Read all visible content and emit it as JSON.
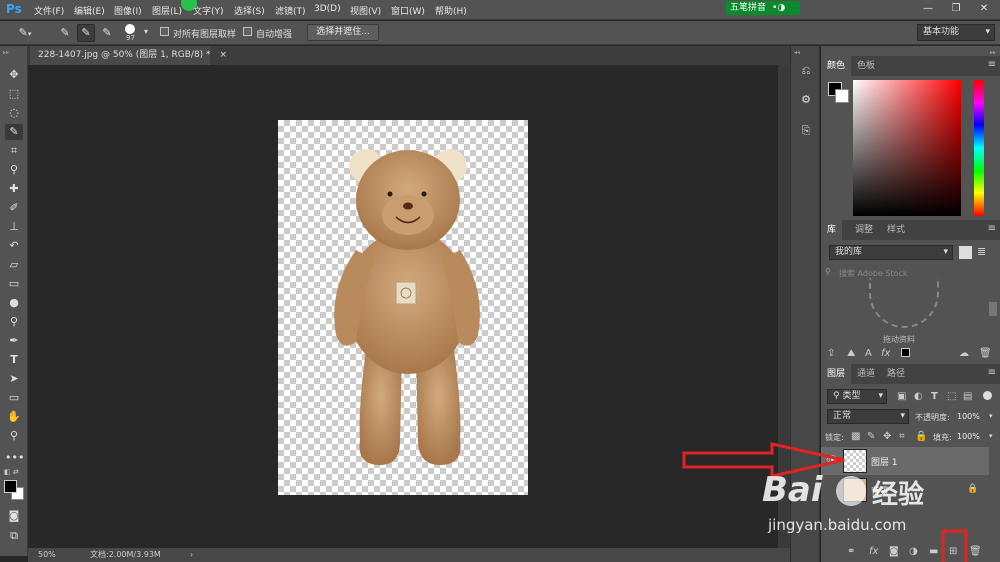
{
  "app": {
    "logo": "Ps"
  },
  "menu": [
    "文件(F)",
    "编辑(E)",
    "图像(I)",
    "图层(L)",
    "文字(Y)",
    "选择(S)",
    "滤镜(T)",
    "3D(D)",
    "视图(V)",
    "窗口(W)",
    "帮助(H)"
  ],
  "ime": {
    "label": "五笔拼音"
  },
  "window_controls": {
    "minimize": "—",
    "restore": "❐",
    "close": "✕"
  },
  "options": {
    "brush_size": "97",
    "sample_all_layers": "对所有图层取样",
    "auto_enhance": "自动增强",
    "select_and_mask": "选择并遮住...",
    "workspace": "基本功能"
  },
  "document": {
    "tab_title": "228-1407.jpg @ 50% (图层 1, RGB/8) *",
    "tab_close": "×"
  },
  "status": {
    "zoom": "50%",
    "doc_size": "文档:2.00M/3.93M",
    "arrow": "›"
  },
  "color_panel": {
    "tabs": [
      "颜色",
      "色板"
    ]
  },
  "library_panel": {
    "tabs": [
      "库",
      "调整",
      "样式"
    ],
    "library_name": "我的库",
    "search_placeholder": "搜索 Adobe Stock",
    "drag_hint": "拖动资料"
  },
  "layers_panel": {
    "tabs": [
      "图层",
      "通道",
      "路径"
    ],
    "filter_kind": "类型",
    "blend_mode": "正常",
    "opacity_label": "不透明度:",
    "opacity_value": "100%",
    "lock_label": "锁定:",
    "fill_label": "填充:",
    "fill_value": "100%",
    "layers": [
      {
        "name": "图层 1",
        "visible": true,
        "selected": true
      },
      {
        "name": "背景",
        "visible": false,
        "locked": true
      }
    ]
  },
  "watermark": {
    "brand": "Bai",
    "brand_cn": "经验",
    "url": "jingyan.baidu.com"
  },
  "colors": {
    "accent": "#31a8ff",
    "annotation": "#e02424",
    "ime_green": "#0c8a2c"
  }
}
